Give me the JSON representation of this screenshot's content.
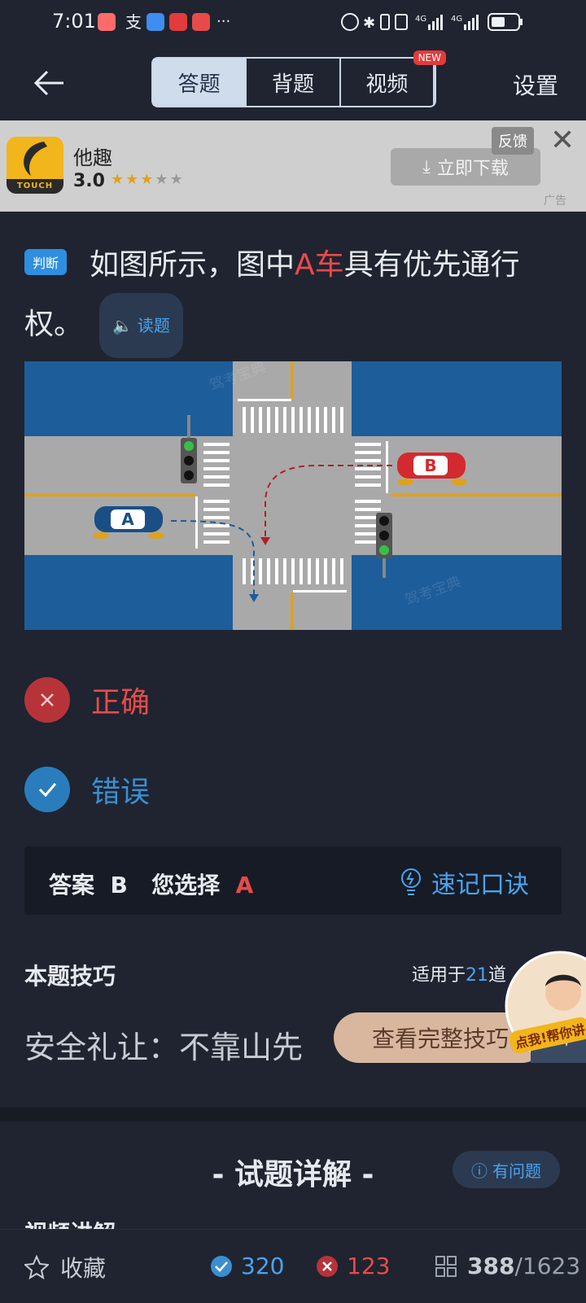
{
  "status_bar": {
    "time": "7:01"
  },
  "nav": {
    "tabs": [
      {
        "label": "答题",
        "active": true
      },
      {
        "label": "背题",
        "active": false
      },
      {
        "label": "视频",
        "active": false
      }
    ],
    "new_badge": "NEW",
    "settings_label": "设置"
  },
  "ad": {
    "app_logo_text": "TOUCH",
    "app_name": "他趣",
    "rating": "3.0",
    "stars_filled": 3,
    "stars_total": 5,
    "download_label": "立即下载",
    "feedback_label": "反馈",
    "ad_tag": "广告"
  },
  "question": {
    "type_badge": "判断",
    "text_before": "如图所示，图中",
    "text_highlight": "A车",
    "text_after": "具有优先通行权。",
    "read_label": "读题",
    "image": {
      "car_a_label": "A",
      "car_b_label": "B",
      "watermark": "驾考宝典"
    }
  },
  "options": [
    {
      "label": "正确",
      "state": "wrong-selected",
      "color": "#e84a4a"
    },
    {
      "label": "错误",
      "state": "correct",
      "color": "#3a8fd0"
    }
  ],
  "answer": {
    "answer_label": "答案",
    "answer_value": "B",
    "your_choice_label": "您选择",
    "your_choice_value": "A",
    "memo_label": "速记口诀"
  },
  "tips": {
    "title": "本题技巧",
    "applies_prefix": "适用于",
    "applies_count": "21",
    "applies_suffix": "道",
    "text": "安全礼让：不靠山先",
    "view_full_label": "查看完整技巧",
    "avatar_caption": "点我!帮你讲"
  },
  "explain": {
    "section_title": "- 试题详解 -",
    "problem_label": "有问题",
    "video_explain_label": "视频讲解"
  },
  "bottom": {
    "favorite_label": "收藏",
    "correct_count": "320",
    "wrong_count": "123",
    "current": "388",
    "total": "/1623"
  },
  "colors": {
    "accent": "#4aa3f0",
    "error": "#e84a4a",
    "background": "#1f2430"
  }
}
